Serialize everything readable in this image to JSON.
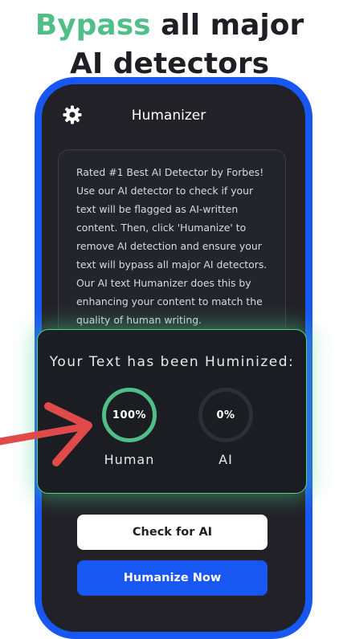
{
  "headline": {
    "accent": "Bypass",
    "rest_line1": " all major",
    "line2": "AI detectors"
  },
  "app": {
    "title": "Humanizer",
    "settings_icon": "gear-icon"
  },
  "text_card": {
    "content": "Rated #1 Best AI Detector by Forbes! Use our AI detector to check if your text will be flagged as AI-written content. Then, click 'Humanize' to remove AI detection and ensure your text will bypass all major AI detectors. Our AI text Humanizer does this by enhancing your content to match the quality of human writing."
  },
  "result": {
    "title": "Your Text has been Huminized:",
    "human": {
      "value": "100%",
      "label": "Human",
      "fraction": 1.0
    },
    "ai": {
      "value": "0%",
      "label": "AI",
      "fraction": 0.0
    }
  },
  "buttons": {
    "check": "Check for AI",
    "humanize": "Humanize Now"
  },
  "colors": {
    "accent_green": "#4fbf87",
    "brand_blue": "#1957f2",
    "arrow_red": "#e04a4a",
    "panel_dark": "#212127"
  }
}
